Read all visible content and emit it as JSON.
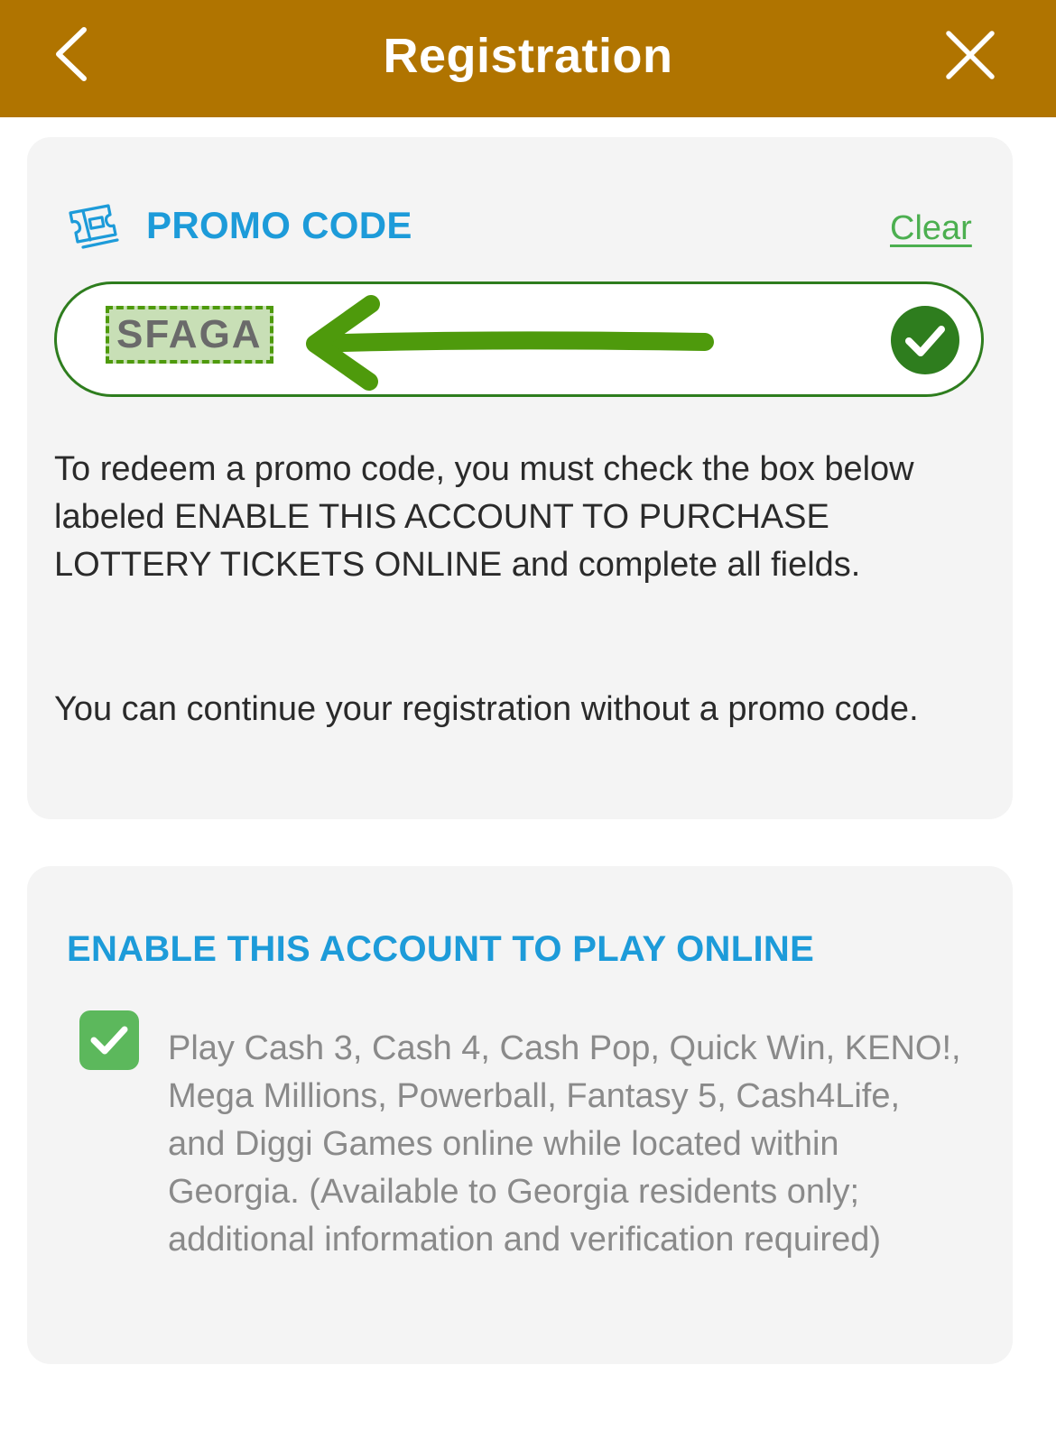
{
  "header": {
    "title": "Registration",
    "back_icon": "chevron-left-icon",
    "close_icon": "close-icon",
    "background": "#b07400"
  },
  "promo": {
    "icon": "ticket-icon",
    "title": "PROMO CODE",
    "clear_label": "Clear",
    "code_value": "SFAGA",
    "valid_icon": "check-circle-icon",
    "annotation": "arrow-left-icon",
    "paragraph_1": "To redeem a promo code, you must check the box below labeled ENABLE THIS ACCOUNT TO PURCHASE LOTTERY TICKETS ONLINE and complete all fields.",
    "paragraph_2": "You can continue your registration without a promo code.",
    "accent_color": "#1d9bd9",
    "valid_color": "#2e7d1e"
  },
  "enable": {
    "title": "ENABLE THIS ACCOUNT TO PLAY ONLINE",
    "checked": true,
    "checkbox_icon": "checkmark-icon",
    "description": "Play Cash 3, Cash 4, Cash Pop, Quick Win, KENO!, Mega Millions, Powerball, Fantasy 5, Cash4Life, and Diggi Games online while located within Georgia. (Available to Georgia residents only; additional information and verification required)",
    "checkbox_color": "#5cb85c"
  }
}
